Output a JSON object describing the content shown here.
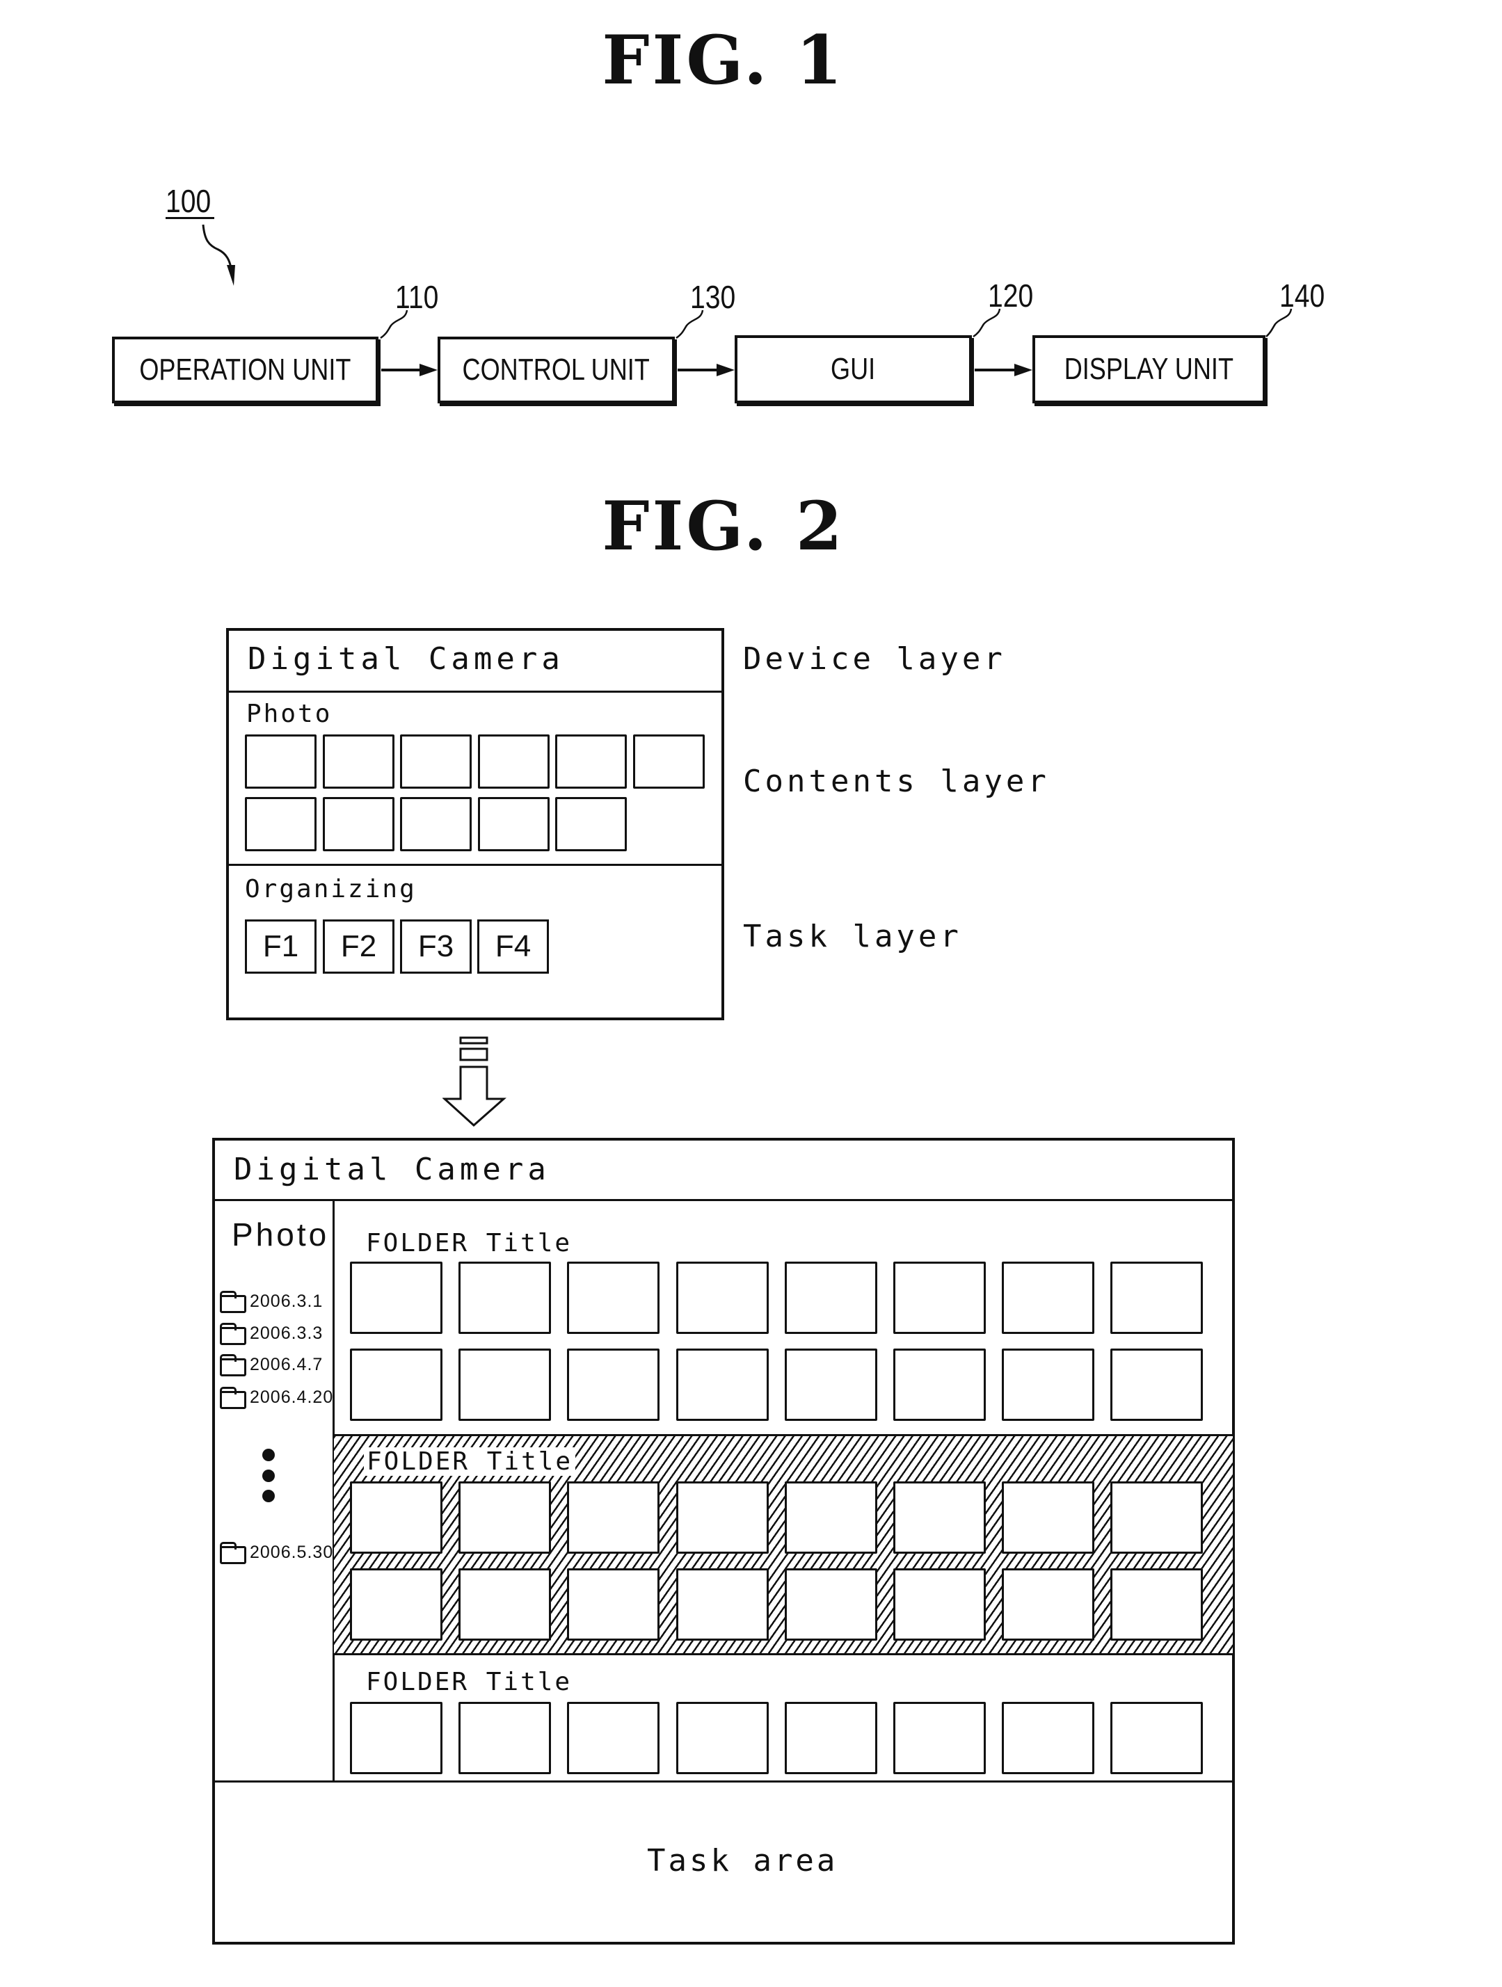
{
  "fig1": {
    "title": "FIG. 1",
    "system_ref": "100",
    "blocks": [
      {
        "label": "OPERATION UNIT",
        "ref": "110"
      },
      {
        "label": "CONTROL UNIT",
        "ref": "130"
      },
      {
        "label": "GUI",
        "ref": "120"
      },
      {
        "label": "DISPLAY UNIT",
        "ref": "140"
      }
    ]
  },
  "fig2": {
    "title": "FIG. 2",
    "top_panel": {
      "device_title": "Digital Camera",
      "contents_title": "Photo",
      "task_title": "Organizing",
      "photo_thumb_count": 11,
      "task_buttons": [
        "F1",
        "F2",
        "F3",
        "F4"
      ],
      "layer_labels": [
        "Device layer",
        "Contents layer",
        "Task layer"
      ]
    },
    "bottom_panel": {
      "device_title": "Digital Camera",
      "sidebar_title": "Photo",
      "folders": [
        "2006.3.1",
        "2006.3.3",
        "2006.4.7",
        "2006.4.20",
        "2006.5.30"
      ],
      "sections": [
        {
          "title": "FOLDER Title",
          "rows": 2,
          "cols": 8,
          "highlighted": false
        },
        {
          "title": "FOLDER Title",
          "rows": 2,
          "cols": 8,
          "highlighted": true
        },
        {
          "title": "FOLDER Title",
          "rows": 1,
          "cols": 8,
          "highlighted": false
        }
      ],
      "task_area_label": "Task area"
    }
  }
}
